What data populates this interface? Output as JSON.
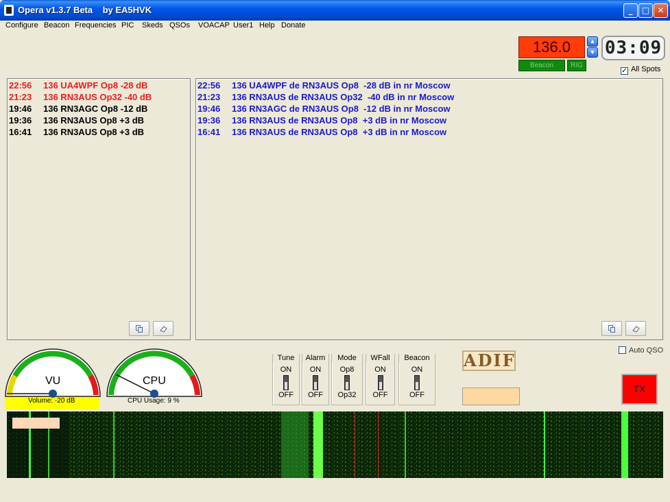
{
  "window": {
    "title": "Opera v1.3.7 Beta    by EA5HVK"
  },
  "menu": [
    "Configure",
    "Beacon",
    "Frequencies",
    "PIC",
    "Skeds",
    "QSOs",
    "VOACAP",
    "User1",
    "Help",
    "Donate"
  ],
  "frequency": {
    "value": "136.0",
    "beacon_label": "Beacon",
    "rig_label": "RIG"
  },
  "clock": "03:09",
  "all_spots": {
    "label": "All Spots",
    "checked": true
  },
  "left_log": [
    {
      "time": "22:56",
      "text": "136 UA4WPF Op8 -28 dB",
      "color": "red"
    },
    {
      "time": "21:23",
      "text": "136 RN3AUS Op32 -40 dB",
      "color": "red"
    },
    {
      "time": "19:46",
      "text": "136 RN3AGC Op8 -12 dB",
      "color": "black"
    },
    {
      "time": "19:36",
      "text": "136 RN3AUS Op8 +3 dB",
      "color": "black"
    },
    {
      "time": "16:41",
      "text": "136 RN3AUS Op8 +3 dB",
      "color": "black"
    }
  ],
  "right_log": [
    {
      "time": "22:56",
      "text": "136 UA4WPF de RN3AUS Op8  -28 dB in nr Moscow"
    },
    {
      "time": "21:23",
      "text": "136 RN3AUS de RN3AUS Op32  -40 dB in nr Moscow"
    },
    {
      "time": "19:46",
      "text": "136 RN3AGC de RN3AUS Op8  -12 dB in nr Moscow"
    },
    {
      "time": "19:36",
      "text": "136 RN3AUS de RN3AUS Op8  +3 dB in nr Moscow"
    },
    {
      "time": "16:41",
      "text": "136 RN3AUS de RN3AUS Op8  +3 dB in nr Moscow"
    }
  ],
  "vu_gauge": {
    "label": "VU",
    "caption": "Volume: -20 dB"
  },
  "cpu_gauge": {
    "label": "CPU",
    "caption": "CPU Usage: 9 %",
    "value_percent": 9
  },
  "switches": [
    {
      "title": "Tune",
      "on": "ON",
      "off": "OFF"
    },
    {
      "title": "Alarm",
      "on": "ON",
      "off": "OFF"
    },
    {
      "title": "Mode",
      "on": "Op8",
      "off": "Op32"
    },
    {
      "title": "WFall",
      "on": "ON",
      "off": "OFF"
    },
    {
      "title": "Beacon",
      "on": "ON",
      "off": "OFF"
    }
  ],
  "adif_label": "ADIF",
  "auto_qso": {
    "label": "Auto QSO",
    "checked": false
  },
  "tx_label": "TX",
  "colors": {
    "freq_bg": "#ff3c0a",
    "tx_bg": "#ff0000",
    "log_red": "#ee1c1c",
    "log_blue": "#1a1ad0"
  }
}
